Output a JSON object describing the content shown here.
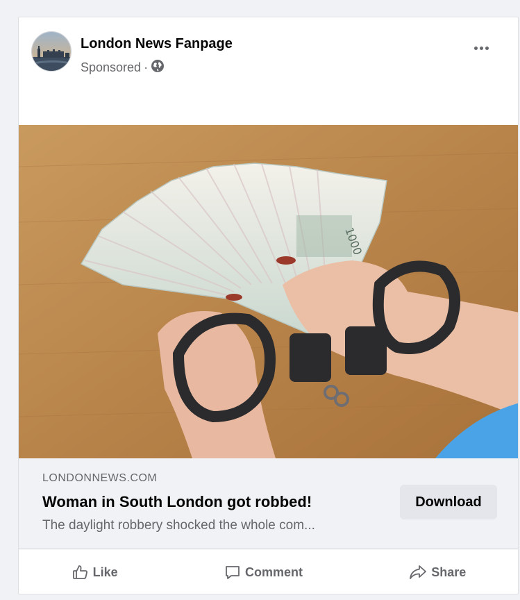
{
  "post": {
    "page_name": "London News Fanpage",
    "sponsored_label": "Sponsored",
    "separator": "·",
    "globe_icon": "globe-icon",
    "more_icon": "more-options-icon"
  },
  "link": {
    "domain": "LONDONNEWS.COM",
    "headline": "Woman in South London got robbed!",
    "description": "The daylight robbery shocked the whole com...",
    "cta_label": "Download"
  },
  "actions": {
    "like": "Like",
    "comment": "Comment",
    "share": "Share"
  },
  "colors": {
    "secondary_text": "#65676b",
    "link_box_bg": "#f0f2f5",
    "cta_bg": "#e4e6eb"
  }
}
